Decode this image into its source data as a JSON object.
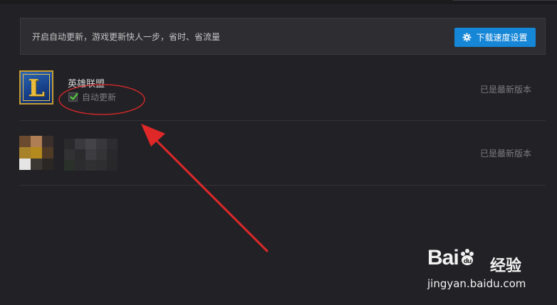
{
  "update_bar": {
    "message": "开启自动更新，游戏更新快人一步，省时、省流量",
    "speed_button_label": "下载速度设置"
  },
  "games": [
    {
      "name": "英雄联盟",
      "icon_letter": "L",
      "auto_update_label": "自动更新",
      "auto_update_checked": true,
      "status": "已是最新版本"
    },
    {
      "name": "",
      "status": "已是最新版本"
    }
  ],
  "watermark": {
    "logo": "Bai",
    "logo_paw": "du",
    "brand_cn": "经验",
    "url": "jingyan.baidu.com"
  },
  "colors": {
    "background": "#222226",
    "button": "#1686d6",
    "annotation_red": "#e02828",
    "icon_gold": "#e9bd3b"
  }
}
